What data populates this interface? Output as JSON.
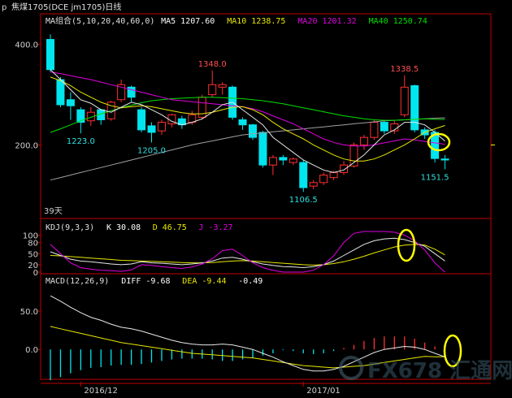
{
  "title": "焦煤1705(DCE jm1705)日线",
  "title_prefix": "p",
  "watermark": "FX678 汇通网",
  "colors": {
    "up": "#ff3030",
    "down": "#00e5ee",
    "ma5": "#e8e8e8",
    "ma10": "#e8e800",
    "ma20": "#e000e0",
    "ma40": "#00e000",
    "ma60": "#a0a0a0",
    "axis": "#c00000",
    "text": "#d0d0d0",
    "highlight": "#ffff00"
  },
  "chart_data": [
    {
      "type": "candlestick",
      "legend": [
        {
          "label": "MA组合(5,10,20,40,60,0)",
          "value": "",
          "color": "#e0e0e0"
        },
        {
          "label": "MA5",
          "value": "1207.60",
          "color": "#ffffff"
        },
        {
          "label": "MA10",
          "value": "1238.75",
          "color": "#e8e800"
        },
        {
          "label": "MA20",
          "value": "1201.32",
          "color": "#e000e0"
        },
        {
          "label": "MA40",
          "value": "1250.74",
          "color": "#00e000"
        }
      ],
      "yticks": [
        "400.0",
        "200.0"
      ],
      "ylim": [
        1060,
        1440
      ],
      "annotations": [
        {
          "text": "1348.0",
          "price": 1348,
          "index": 16
        },
        {
          "text": "1223.0",
          "price": 1223,
          "index": 3
        },
        {
          "text": "1205.0",
          "price": 1205,
          "index": 10
        },
        {
          "text": "1106.5",
          "price": 1106.5,
          "index": 25
        },
        {
          "text": "1338.5",
          "price": 1338.5,
          "index": 35
        },
        {
          "text": "1151.5",
          "price": 1151.5,
          "index": 38
        }
      ],
      "days_label": "39天",
      "candles": [
        [
          1410,
          1350,
          1420,
          1345
        ],
        [
          1330,
          1280,
          1335,
          1275
        ],
        [
          1290,
          1278,
          1305,
          1250
        ],
        [
          1270,
          1245,
          1275,
          1223
        ],
        [
          1248,
          1265,
          1275,
          1238
        ],
        [
          1270,
          1250,
          1272,
          1240
        ],
        [
          1252,
          1285,
          1288,
          1248
        ],
        [
          1290,
          1320,
          1330,
          1285
        ],
        [
          1315,
          1295,
          1318,
          1285
        ],
        [
          1270,
          1230,
          1275,
          1225
        ],
        [
          1238,
          1225,
          1245,
          1205
        ],
        [
          1228,
          1245,
          1250,
          1220
        ],
        [
          1242,
          1260,
          1262,
          1235
        ],
        [
          1252,
          1240,
          1258,
          1232
        ],
        [
          1245,
          1260,
          1268,
          1240
        ],
        [
          1255,
          1295,
          1300,
          1250
        ],
        [
          1300,
          1320,
          1348,
          1295
        ],
        [
          1315,
          1320,
          1325,
          1300
        ],
        [
          1315,
          1255,
          1318,
          1250
        ],
        [
          1250,
          1240,
          1255,
          1230
        ],
        [
          1240,
          1215,
          1242,
          1210
        ],
        [
          1225,
          1160,
          1228,
          1155
        ],
        [
          1160,
          1175,
          1180,
          1140
        ],
        [
          1175,
          1170,
          1180,
          1160
        ],
        [
          1165,
          1172,
          1175,
          1160
        ],
        [
          1165,
          1115,
          1170,
          1106.5
        ],
        [
          1118,
          1125,
          1130,
          1112
        ],
        [
          1125,
          1140,
          1145,
          1120
        ],
        [
          1135,
          1145,
          1148,
          1130
        ],
        [
          1145,
          1160,
          1168,
          1140
        ],
        [
          1158,
          1200,
          1205,
          1155
        ],
        [
          1200,
          1215,
          1220,
          1190
        ],
        [
          1215,
          1245,
          1250,
          1210
        ],
        [
          1245,
          1228,
          1250,
          1222
        ],
        [
          1228,
          1242,
          1248,
          1222
        ],
        [
          1260,
          1315,
          1338.5,
          1255
        ],
        [
          1318,
          1230,
          1320,
          1225
        ],
        [
          1230,
          1220,
          1235,
          1212
        ],
        [
          1225,
          1173,
          1230,
          1165
        ],
        [
          1172,
          1170,
          1180,
          1151.5
        ]
      ],
      "ma5": [
        1350,
        1330,
        1310,
        1290,
        1283,
        1270,
        1265,
        1275,
        1285,
        1280,
        1270,
        1260,
        1247,
        1240,
        1245,
        1252,
        1265,
        1280,
        1285,
        1270,
        1255,
        1240,
        1215,
        1200,
        1185,
        1170,
        1160,
        1150,
        1145,
        1150,
        1165,
        1180,
        1200,
        1220,
        1230,
        1245,
        1245,
        1240,
        1225,
        1207.6
      ],
      "ma10": [
        1335,
        1328,
        1318,
        1305,
        1295,
        1285,
        1278,
        1274,
        1276,
        1278,
        1276,
        1272,
        1268,
        1264,
        1262,
        1262,
        1265,
        1270,
        1275,
        1276,
        1270,
        1260,
        1245,
        1232,
        1222,
        1212,
        1200,
        1190,
        1180,
        1172,
        1168,
        1168,
        1172,
        1180,
        1190,
        1200,
        1212,
        1225,
        1232,
        1238.75
      ],
      "ma20": [
        1345,
        1342,
        1338,
        1334,
        1330,
        1325,
        1320,
        1315,
        1310,
        1305,
        1300,
        1295,
        1290,
        1288,
        1286,
        1284,
        1282,
        1280,
        1278,
        1276,
        1272,
        1266,
        1258,
        1250,
        1242,
        1232,
        1222,
        1212,
        1205,
        1200,
        1198,
        1198,
        1200,
        1204,
        1208,
        1212,
        1210,
        1207,
        1204,
        1201.32
      ],
      "ma40": [
        1225,
        1232,
        1240,
        1248,
        1255,
        1262,
        1268,
        1274,
        1279,
        1284,
        1288,
        1290,
        1292,
        1293,
        1294,
        1295,
        1295,
        1294,
        1293,
        1292,
        1290,
        1288,
        1285,
        1282,
        1278,
        1274,
        1270,
        1266,
        1262,
        1258,
        1255,
        1252,
        1250,
        1249,
        1249,
        1250,
        1251,
        1252,
        1251,
        1250.74
      ],
      "ma60": [
        1130,
        1135,
        1140,
        1145,
        1150,
        1155,
        1160,
        1165,
        1170,
        1175,
        1180,
        1185,
        1190,
        1195,
        1200,
        1204,
        1208,
        1212,
        1216,
        1220,
        1222,
        1224,
        1226,
        1228,
        1230,
        1232,
        1234,
        1236,
        1238,
        1240,
        1242,
        1244,
        1246,
        1248,
        1249,
        1250,
        1251,
        1252,
        1253,
        1254
      ]
    },
    {
      "type": "line",
      "legend": [
        {
          "label": "KDJ(9,3,3)",
          "value": "",
          "color": "#e0e0e0"
        },
        {
          "label": "K",
          "value": "30.08",
          "color": "#ffffff"
        },
        {
          "label": "D",
          "value": "46.75",
          "color": "#e8e800"
        },
        {
          "label": "J",
          "value": "-3.27",
          "color": "#e000e0"
        }
      ],
      "yticks": [
        "100",
        "80",
        "50",
        "20",
        "0"
      ],
      "ylim": [
        0,
        110
      ],
      "k": [
        55,
        45,
        35,
        30,
        28,
        25,
        22,
        20,
        22,
        28,
        25,
        24,
        22,
        20,
        22,
        25,
        30,
        38,
        40,
        35,
        28,
        22,
        18,
        15,
        14,
        12,
        15,
        20,
        30,
        45,
        60,
        75,
        85,
        90,
        92,
        88,
        80,
        70,
        50,
        30.08
      ],
      "d": [
        45,
        44,
        42,
        40,
        38,
        36,
        34,
        32,
        31,
        30,
        29,
        28,
        27,
        26,
        25,
        25,
        26,
        28,
        30,
        31,
        30,
        28,
        26,
        24,
        22,
        20,
        19,
        20,
        23,
        28,
        35,
        43,
        52,
        60,
        68,
        73,
        75,
        73,
        62,
        46.75
      ],
      "j": [
        75,
        50,
        25,
        12,
        8,
        5,
        4,
        2,
        6,
        20,
        18,
        15,
        12,
        10,
        14,
        22,
        36,
        58,
        62,
        45,
        25,
        12,
        5,
        0,
        -2,
        -4,
        5,
        20,
        44,
        80,
        105,
        110,
        110,
        110,
        108,
        100,
        85,
        60,
        25,
        -3.27
      ]
    },
    {
      "type": "bar+line",
      "legend": [
        {
          "label": "MACD(12,26,9)",
          "value": "",
          "color": "#e0e0e0"
        },
        {
          "label": "DIFF",
          "value": "-9.68",
          "color": "#ffffff"
        },
        {
          "label": "DEA",
          "value": "-9.44",
          "color": "#e8e800"
        },
        {
          "label": "",
          "value": "-0.49",
          "color": "#ffffff"
        }
      ],
      "yticks": [
        "50.0",
        "0.0"
      ],
      "ylim": [
        -40,
        85
      ],
      "xlabels": [
        {
          "text": "2016/12",
          "index": 3
        },
        {
          "text": "2017/01",
          "index": 25
        }
      ],
      "diff": [
        70,
        63,
        55,
        48,
        42,
        38,
        33,
        29,
        27,
        24,
        20,
        16,
        12,
        9,
        7,
        6,
        6,
        7,
        6,
        3,
        0,
        -5,
        -10,
        -16,
        -21,
        -26,
        -28,
        -28,
        -26,
        -22,
        -16,
        -10,
        -4,
        0,
        2,
        4,
        3,
        0,
        -5,
        -9.68
      ],
      "dea": [
        30,
        27,
        24,
        21,
        18,
        15,
        12,
        9,
        7,
        5,
        3,
        1,
        -1,
        -3,
        -5,
        -6,
        -7,
        -8,
        -9,
        -10,
        -11,
        -13,
        -15,
        -17,
        -19,
        -21,
        -22,
        -23,
        -24,
        -23,
        -22,
        -21,
        -19,
        -17,
        -15,
        -13,
        -11,
        -9,
        -9.5,
        -9.44
      ],
      "macd": [
        -40,
        -36,
        -31,
        -27,
        -24,
        -23,
        -21,
        -20,
        -20,
        -19,
        -17,
        -15,
        -13,
        -12,
        -12,
        -12,
        -13,
        -15,
        -15,
        -13,
        -11,
        -8,
        -5,
        -1,
        -2,
        -5,
        -6,
        -5,
        -2,
        2,
        6,
        11,
        15,
        17,
        17,
        17,
        14,
        9,
        4,
        -0.49
      ]
    }
  ]
}
